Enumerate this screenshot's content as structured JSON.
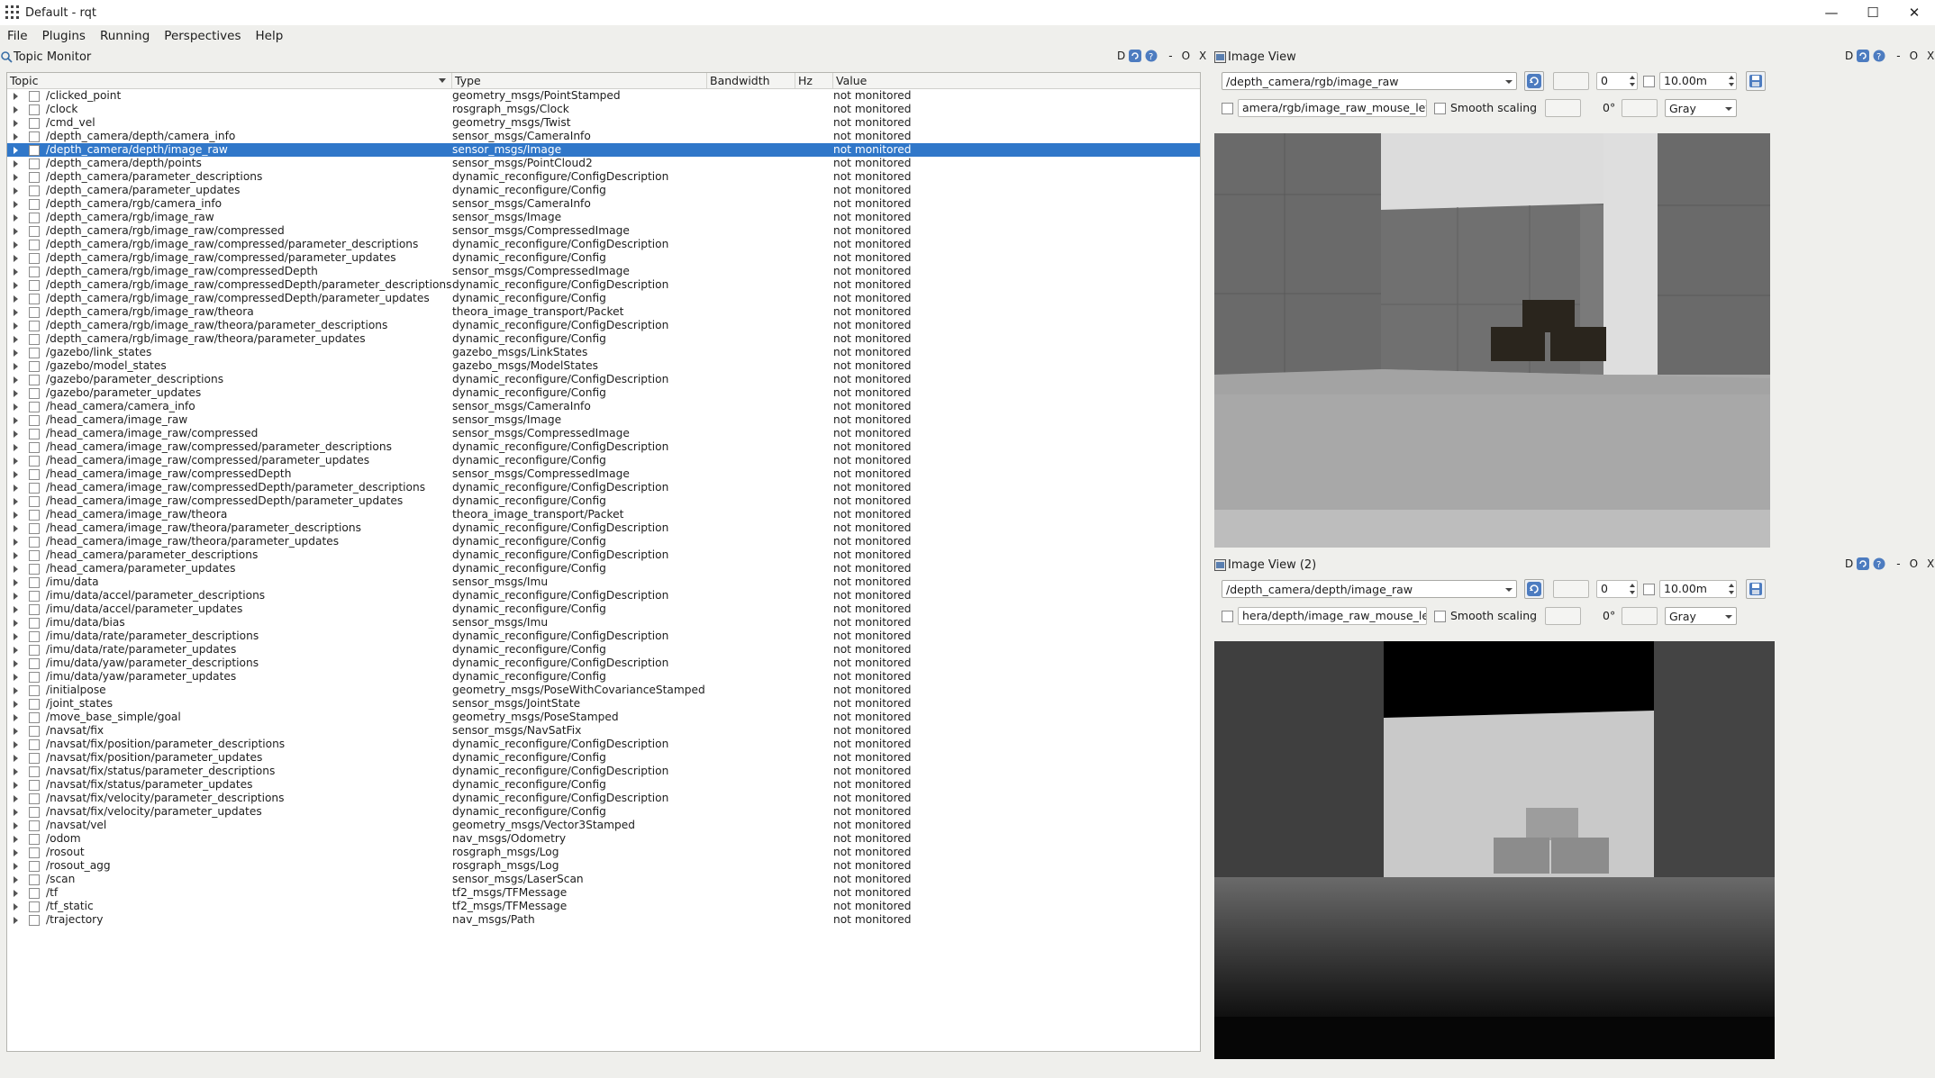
{
  "window": {
    "title": "Default - rqt",
    "minimize": "—",
    "maximize": "☐",
    "close": "✕"
  },
  "menu": [
    "File",
    "Plugins",
    "Running",
    "Perspectives",
    "Help"
  ],
  "topic_monitor": {
    "title": "Topic Monitor",
    "dock_buttons": "D",
    "dock_controls": [
      "-",
      "O",
      "X"
    ],
    "columns": [
      "Topic",
      "Type",
      "Bandwidth",
      "Hz",
      "Value"
    ],
    "rows": [
      [
        "/clicked_point",
        "geometry_msgs/PointStamped",
        "not monitored"
      ],
      [
        "/clock",
        "rosgraph_msgs/Clock",
        "not monitored"
      ],
      [
        "/cmd_vel",
        "geometry_msgs/Twist",
        "not monitored"
      ],
      [
        "/depth_camera/depth/camera_info",
        "sensor_msgs/CameraInfo",
        "not monitored"
      ],
      [
        "/depth_camera/depth/image_raw",
        "sensor_msgs/Image",
        "not monitored"
      ],
      [
        "/depth_camera/depth/points",
        "sensor_msgs/PointCloud2",
        "not monitored"
      ],
      [
        "/depth_camera/parameter_descriptions",
        "dynamic_reconfigure/ConfigDescription",
        "not monitored"
      ],
      [
        "/depth_camera/parameter_updates",
        "dynamic_reconfigure/Config",
        "not monitored"
      ],
      [
        "/depth_camera/rgb/camera_info",
        "sensor_msgs/CameraInfo",
        "not monitored"
      ],
      [
        "/depth_camera/rgb/image_raw",
        "sensor_msgs/Image",
        "not monitored"
      ],
      [
        "/depth_camera/rgb/image_raw/compressed",
        "sensor_msgs/CompressedImage",
        "not monitored"
      ],
      [
        "/depth_camera/rgb/image_raw/compressed/parameter_descriptions",
        "dynamic_reconfigure/ConfigDescription",
        "not monitored"
      ],
      [
        "/depth_camera/rgb/image_raw/compressed/parameter_updates",
        "dynamic_reconfigure/Config",
        "not monitored"
      ],
      [
        "/depth_camera/rgb/image_raw/compressedDepth",
        "sensor_msgs/CompressedImage",
        "not monitored"
      ],
      [
        "/depth_camera/rgb/image_raw/compressedDepth/parameter_descriptions",
        "dynamic_reconfigure/ConfigDescription",
        "not monitored"
      ],
      [
        "/depth_camera/rgb/image_raw/compressedDepth/parameter_updates",
        "dynamic_reconfigure/Config",
        "not monitored"
      ],
      [
        "/depth_camera/rgb/image_raw/theora",
        "theora_image_transport/Packet",
        "not monitored"
      ],
      [
        "/depth_camera/rgb/image_raw/theora/parameter_descriptions",
        "dynamic_reconfigure/ConfigDescription",
        "not monitored"
      ],
      [
        "/depth_camera/rgb/image_raw/theora/parameter_updates",
        "dynamic_reconfigure/Config",
        "not monitored"
      ],
      [
        "/gazebo/link_states",
        "gazebo_msgs/LinkStates",
        "not monitored"
      ],
      [
        "/gazebo/model_states",
        "gazebo_msgs/ModelStates",
        "not monitored"
      ],
      [
        "/gazebo/parameter_descriptions",
        "dynamic_reconfigure/ConfigDescription",
        "not monitored"
      ],
      [
        "/gazebo/parameter_updates",
        "dynamic_reconfigure/Config",
        "not monitored"
      ],
      [
        "/head_camera/camera_info",
        "sensor_msgs/CameraInfo",
        "not monitored"
      ],
      [
        "/head_camera/image_raw",
        "sensor_msgs/Image",
        "not monitored"
      ],
      [
        "/head_camera/image_raw/compressed",
        "sensor_msgs/CompressedImage",
        "not monitored"
      ],
      [
        "/head_camera/image_raw/compressed/parameter_descriptions",
        "dynamic_reconfigure/ConfigDescription",
        "not monitored"
      ],
      [
        "/head_camera/image_raw/compressed/parameter_updates",
        "dynamic_reconfigure/Config",
        "not monitored"
      ],
      [
        "/head_camera/image_raw/compressedDepth",
        "sensor_msgs/CompressedImage",
        "not monitored"
      ],
      [
        "/head_camera/image_raw/compressedDepth/parameter_descriptions",
        "dynamic_reconfigure/ConfigDescription",
        "not monitored"
      ],
      [
        "/head_camera/image_raw/compressedDepth/parameter_updates",
        "dynamic_reconfigure/Config",
        "not monitored"
      ],
      [
        "/head_camera/image_raw/theora",
        "theora_image_transport/Packet",
        "not monitored"
      ],
      [
        "/head_camera/image_raw/theora/parameter_descriptions",
        "dynamic_reconfigure/ConfigDescription",
        "not monitored"
      ],
      [
        "/head_camera/image_raw/theora/parameter_updates",
        "dynamic_reconfigure/Config",
        "not monitored"
      ],
      [
        "/head_camera/parameter_descriptions",
        "dynamic_reconfigure/ConfigDescription",
        "not monitored"
      ],
      [
        "/head_camera/parameter_updates",
        "dynamic_reconfigure/Config",
        "not monitored"
      ],
      [
        "/imu/data",
        "sensor_msgs/Imu",
        "not monitored"
      ],
      [
        "/imu/data/accel/parameter_descriptions",
        "dynamic_reconfigure/ConfigDescription",
        "not monitored"
      ],
      [
        "/imu/data/accel/parameter_updates",
        "dynamic_reconfigure/Config",
        "not monitored"
      ],
      [
        "/imu/data/bias",
        "sensor_msgs/Imu",
        "not monitored"
      ],
      [
        "/imu/data/rate/parameter_descriptions",
        "dynamic_reconfigure/ConfigDescription",
        "not monitored"
      ],
      [
        "/imu/data/rate/parameter_updates",
        "dynamic_reconfigure/Config",
        "not monitored"
      ],
      [
        "/imu/data/yaw/parameter_descriptions",
        "dynamic_reconfigure/ConfigDescription",
        "not monitored"
      ],
      [
        "/imu/data/yaw/parameter_updates",
        "dynamic_reconfigure/Config",
        "not monitored"
      ],
      [
        "/initialpose",
        "geometry_msgs/PoseWithCovarianceStamped",
        "not monitored"
      ],
      [
        "/joint_states",
        "sensor_msgs/JointState",
        "not monitored"
      ],
      [
        "/move_base_simple/goal",
        "geometry_msgs/PoseStamped",
        "not monitored"
      ],
      [
        "/navsat/fix",
        "sensor_msgs/NavSatFix",
        "not monitored"
      ],
      [
        "/navsat/fix/position/parameter_descriptions",
        "dynamic_reconfigure/ConfigDescription",
        "not monitored"
      ],
      [
        "/navsat/fix/position/parameter_updates",
        "dynamic_reconfigure/Config",
        "not monitored"
      ],
      [
        "/navsat/fix/status/parameter_descriptions",
        "dynamic_reconfigure/ConfigDescription",
        "not monitored"
      ],
      [
        "/navsat/fix/status/parameter_updates",
        "dynamic_reconfigure/Config",
        "not monitored"
      ],
      [
        "/navsat/fix/velocity/parameter_descriptions",
        "dynamic_reconfigure/ConfigDescription",
        "not monitored"
      ],
      [
        "/navsat/fix/velocity/parameter_updates",
        "dynamic_reconfigure/Config",
        "not monitored"
      ],
      [
        "/navsat/vel",
        "geometry_msgs/Vector3Stamped",
        "not monitored"
      ],
      [
        "/odom",
        "nav_msgs/Odometry",
        "not monitored"
      ],
      [
        "/rosout",
        "rosgraph_msgs/Log",
        "not monitored"
      ],
      [
        "/rosout_agg",
        "rosgraph_msgs/Log",
        "not monitored"
      ],
      [
        "/scan",
        "sensor_msgs/LaserScan",
        "not monitored"
      ],
      [
        "/tf",
        "tf2_msgs/TFMessage",
        "not monitored"
      ],
      [
        "/tf_static",
        "tf2_msgs/TFMessage",
        "not monitored"
      ],
      [
        "/trajectory",
        "nav_msgs/Path",
        "not monitored"
      ]
    ],
    "selected_row": "/depth_camera/depth/image_raw"
  },
  "image_views": [
    {
      "title": "Image View",
      "dock_buttons": "D",
      "dock_controls": [
        "-",
        "O",
        "X"
      ],
      "topic": "/depth_camera/rgb/image_raw",
      "spin_value": "0",
      "max_range": "10.00m",
      "mouse_topic": "amera/rgb/image_raw_mouse_left",
      "smooth_label": "Smooth scaling",
      "rotation": "0°",
      "color_scheme": "Gray"
    },
    {
      "title": "Image View (2)",
      "dock_buttons": "D",
      "dock_controls": [
        "-",
        "O",
        "X"
      ],
      "topic": "/depth_camera/depth/image_raw",
      "spin_value": "0",
      "max_range": "10.00m",
      "mouse_topic": "hera/depth/image_raw_mouse_left",
      "smooth_label": "Smooth scaling",
      "rotation": "0°",
      "color_scheme": "Gray"
    }
  ],
  "colors": {
    "selection": "#3077c9",
    "background": "#efefec"
  }
}
